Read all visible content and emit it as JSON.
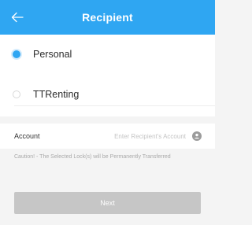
{
  "header": {
    "title": "Recipient",
    "back_icon": "arrow-left-icon",
    "background": "#2fa6f2"
  },
  "options": [
    {
      "label": "Personal",
      "selected": true
    },
    {
      "label": "TTRenting",
      "selected": false
    }
  ],
  "account": {
    "label": "Account",
    "value": "",
    "placeholder": "Enter Recipient's Account",
    "contact_icon": "person-icon"
  },
  "caution_text": "Caution! - The Selected Lock(s) will be Permanently Transferred",
  "next_button": {
    "label": "Next",
    "enabled": false,
    "color": "#c6c6c6"
  }
}
